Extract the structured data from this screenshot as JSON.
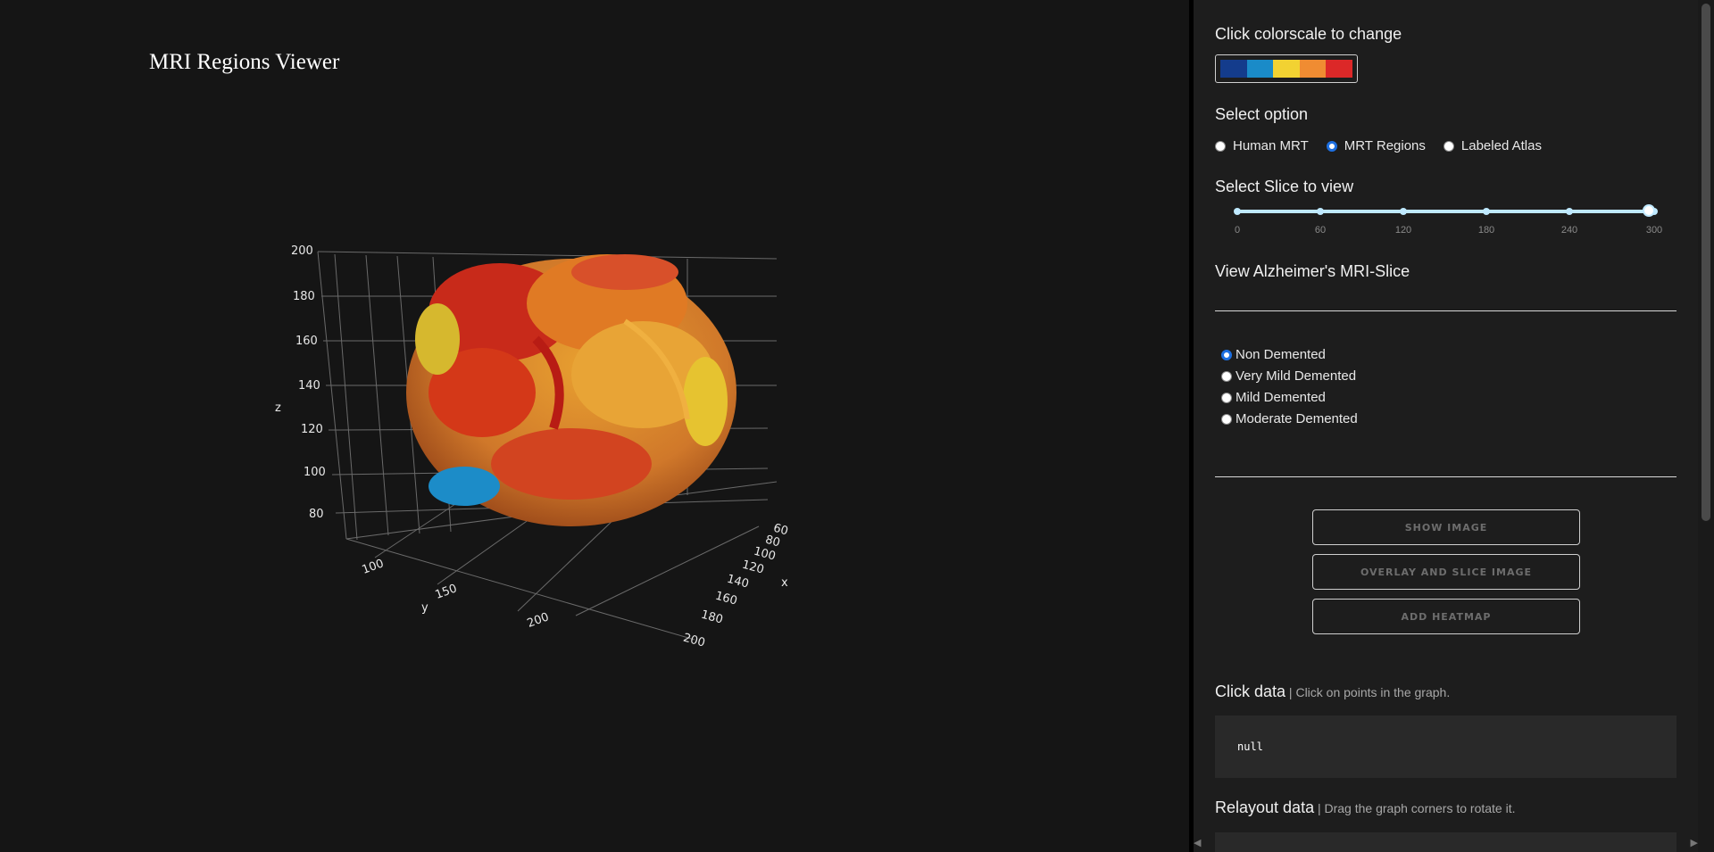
{
  "app_title": "MRI Regions Viewer",
  "graph": {
    "axis_z": {
      "label": "z",
      "ticks": [
        "200",
        "180",
        "160",
        "140",
        "120",
        "100",
        "80"
      ]
    },
    "axis_y": {
      "label": "y",
      "ticks": [
        "100",
        "150",
        "200"
      ]
    },
    "axis_x": {
      "label": "x",
      "ticks": [
        "60",
        "80",
        "100",
        "120",
        "140",
        "160",
        "180",
        "200"
      ]
    }
  },
  "controls": {
    "colorscale_label": "Click colorscale to change",
    "colorscale": [
      "#143c8c",
      "#1a8bc8",
      "#f2d232",
      "#f08c32",
      "#dc2828"
    ],
    "option_label": "Select option",
    "options": [
      {
        "label": "Human MRT",
        "checked": false
      },
      {
        "label": "MRT Regions",
        "checked": true
      },
      {
        "label": "Labeled Atlas",
        "checked": false
      }
    ],
    "slice_label": "Select Slice to view",
    "slider": {
      "marks": [
        "0",
        "60",
        "120",
        "180",
        "240",
        "300"
      ],
      "value": 300,
      "min": 0,
      "max": 300
    },
    "alz_label": "View Alzheimer's MRI-Slice",
    "dementia_options": [
      {
        "label": "Non Demented",
        "checked": true
      },
      {
        "label": "Very Mild Demented",
        "checked": false
      },
      {
        "label": "Mild Demented",
        "checked": false
      },
      {
        "label": "Moderate Demented",
        "checked": false
      }
    ],
    "buttons": {
      "show_image": "SHOW IMAGE",
      "overlay": "OVERLAY AND SLICE IMAGE",
      "heatmap": "ADD HEATMAP"
    },
    "click_data": {
      "title": "Click data",
      "hint": "Click on points in the graph.",
      "value": "null"
    },
    "relayout_data": {
      "title": "Relayout data",
      "hint": "Drag the graph corners to rotate it."
    }
  }
}
